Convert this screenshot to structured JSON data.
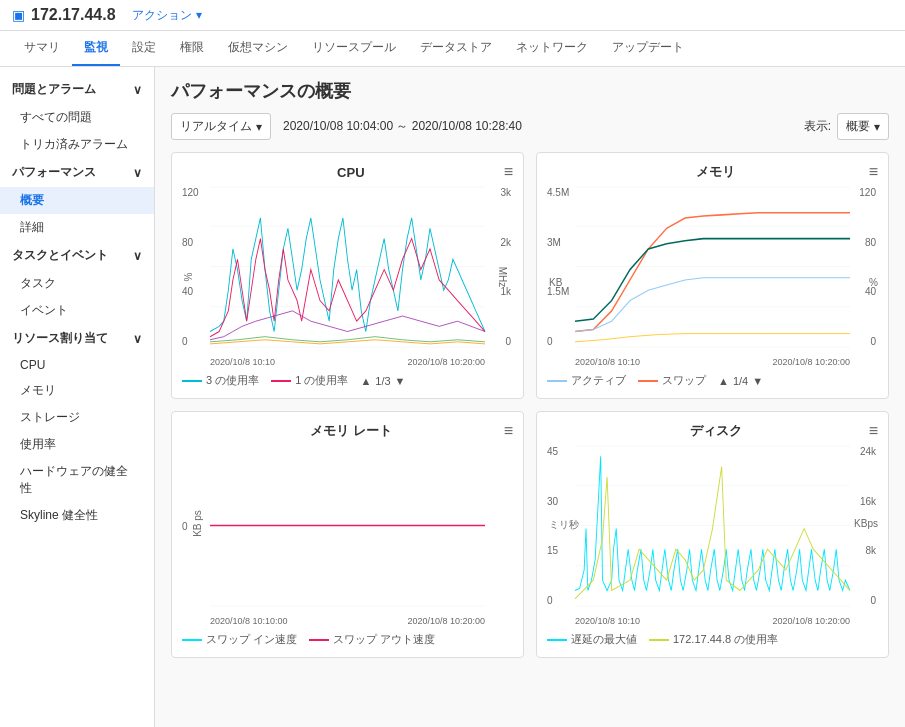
{
  "topbar": {
    "device_icon": "▣",
    "ip_address": "172.17.44.8",
    "action_label": "アクション",
    "action_chevron": "▾"
  },
  "nav_tabs": [
    {
      "label": "サマリ",
      "active": false
    },
    {
      "label": "監視",
      "active": true
    },
    {
      "label": "設定",
      "active": false
    },
    {
      "label": "権限",
      "active": false
    },
    {
      "label": "仮想マシン",
      "active": false
    },
    {
      "label": "リソースプール",
      "active": false
    },
    {
      "label": "データストア",
      "active": false
    },
    {
      "label": "ネットワーク",
      "active": false
    },
    {
      "label": "アップデート",
      "active": false
    }
  ],
  "sidebar": {
    "sections": [
      {
        "label": "問題とアラーム",
        "items": [
          "すべての問題",
          "トリカ済みアラーム"
        ]
      },
      {
        "label": "パフォーマンス",
        "items": [
          "概要",
          "詳細"
        ]
      },
      {
        "label": "タスクとイベント",
        "items": [
          "タスク",
          "イベント"
        ]
      },
      {
        "label": "リソース割り当て",
        "items": [
          "CPU",
          "メモリ",
          "ストレージ"
        ]
      }
    ],
    "standalone": [
      "使用率",
      "ハードウェアの健全性",
      "Skyline 健全性"
    ]
  },
  "main": {
    "page_title": "パフォーマンスの概要",
    "toolbar": {
      "realtime_label": "リアルタイム",
      "time_range": "2020/10/08 10:04:00 ～ 2020/10/08 10:28:40",
      "display_label": "表示:",
      "display_value": "概要"
    },
    "charts": [
      {
        "id": "cpu",
        "title": "CPU",
        "y_left_labels": [
          "120",
          "80",
          "40",
          "0"
        ],
        "y_right_labels": [
          "3k",
          "2k",
          "1k",
          "0"
        ],
        "y_left_unit": "%",
        "y_right_unit": "MHz",
        "x_labels": [
          "2020/10/8 10:10",
          "2020/10/8 10:20:00"
        ],
        "legends": [
          {
            "color": "#00bcd4",
            "label": "3 の使用率"
          },
          {
            "color": "#e91e63",
            "label": "1 の使用率"
          }
        ],
        "nav": "1/3"
      },
      {
        "id": "memory",
        "title": "メモリ",
        "y_left_labels": [
          "4.5M",
          "3M",
          "1.5M",
          "0"
        ],
        "y_right_labels": [
          "120",
          "80",
          "40",
          "0"
        ],
        "y_left_unit": "KB",
        "y_right_unit": "%",
        "x_labels": [
          "2020/10/8 10:10",
          "2020/10/8 10:20:00"
        ],
        "legends": [
          {
            "color": "#90caf9",
            "label": "アクティブ"
          },
          {
            "color": "#ff7043",
            "label": "スワップ"
          }
        ],
        "nav": "1/4"
      },
      {
        "id": "memory-rate",
        "title": "メモリ レート",
        "y_left_labels": [
          "",
          "0",
          ""
        ],
        "y_right_labels": [],
        "y_left_unit": "KB ps",
        "y_right_unit": "",
        "x_labels": [
          "2020/10/8 10:10:00",
          "2020/10/8 10:20:00"
        ],
        "legends": [
          {
            "color": "#00e5ff",
            "label": "スワップ イン速度"
          },
          {
            "color": "#e91e63",
            "label": "スワップ アウト速度"
          }
        ],
        "nav": ""
      },
      {
        "id": "disk",
        "title": "ディスク",
        "y_left_labels": [
          "45",
          "30",
          "15",
          "0"
        ],
        "y_right_labels": [
          "24k",
          "16k",
          "8k",
          "0"
        ],
        "y_left_unit": "ミリ秒",
        "y_right_unit": "KBps",
        "x_labels": [
          "2020/10/8 10:10",
          "2020/10/8 10:20:00"
        ],
        "legends": [
          {
            "color": "#00e5ff",
            "label": "遅延の最大値"
          },
          {
            "color": "#cddc39",
            "label": "172.17.44.8 の使用率"
          }
        ],
        "nav": ""
      }
    ]
  }
}
